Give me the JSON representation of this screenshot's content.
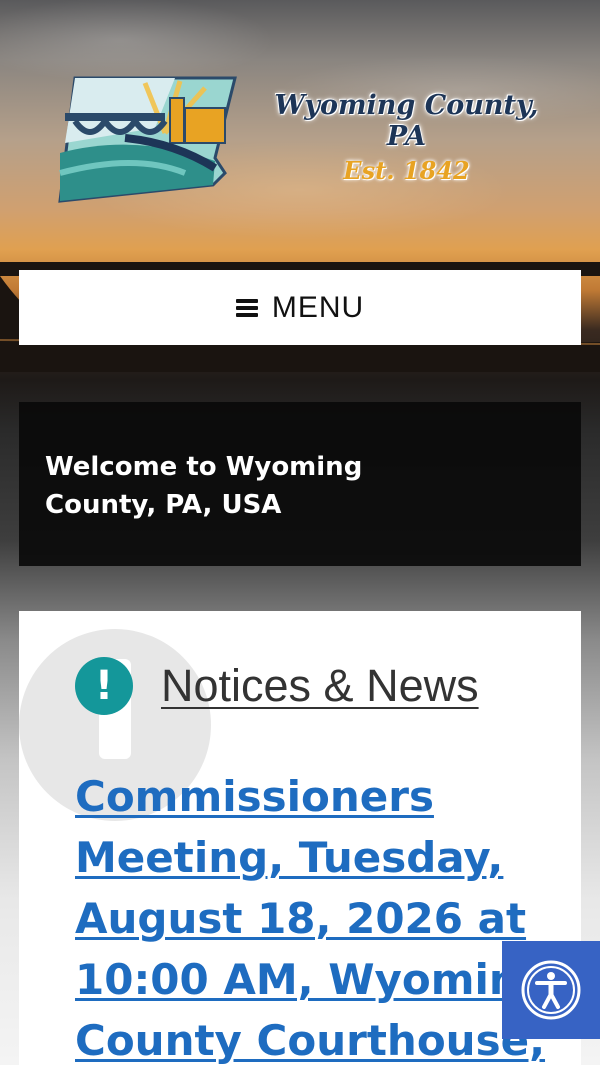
{
  "header": {
    "logo_title": "Wyoming County, PA",
    "logo_est": "Est. 1842"
  },
  "nav": {
    "menu_label": "MENU",
    "menu_icon": "hamburger-icon"
  },
  "welcome": {
    "text": "Welcome to Wyoming County, PA, USA"
  },
  "notices": {
    "title": "Notices & News",
    "icon": "exclamation-icon",
    "first_item": "Commissioners Meeting, Tuesday, August 18, 2026 at 10:00 AM, Wyoming County Courthouse,"
  },
  "accessibility": {
    "icon": "accessibility-icon"
  },
  "colors": {
    "teal": "#14979a",
    "link_blue": "#1e6cc0",
    "a11y_blue": "#3763c4",
    "logo_navy": "#1d3557",
    "logo_gold": "#e8a323"
  }
}
